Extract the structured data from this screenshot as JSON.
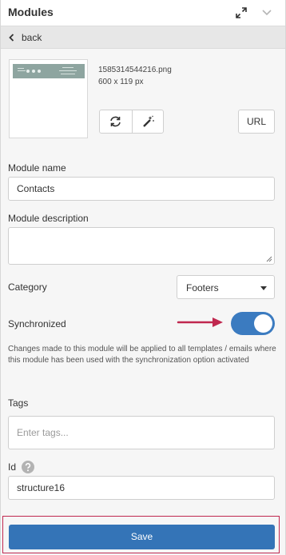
{
  "header": {
    "title": "Modules"
  },
  "back": {
    "label": "back"
  },
  "image": {
    "file_name": "1585314544216.png",
    "dimensions": "600 x 119 px"
  },
  "image_actions": {
    "url_label": "URL"
  },
  "module_name": {
    "label": "Module name",
    "value": "Contacts"
  },
  "module_description": {
    "label": "Module description",
    "value": ""
  },
  "category": {
    "label": "Category",
    "selected": "Footers"
  },
  "synchronized": {
    "label": "Synchronized",
    "enabled": true,
    "note": "Changes made to this module will be applied to all templates / emails where this module has been used with the synchronization option activated"
  },
  "tags": {
    "label": "Tags",
    "placeholder": "Enter tags..."
  },
  "id_field": {
    "label": "Id",
    "value": "structure16"
  },
  "save": {
    "label": "Save"
  },
  "colors": {
    "accent": "#3b7bc0",
    "save_button": "#3474b7",
    "arrow": "#c0284f"
  },
  "icons": [
    "expand-icon",
    "chevron-down-icon",
    "chevron-left-icon",
    "refresh-icon",
    "magic-wand-icon",
    "question-icon",
    "caret-down-icon"
  ]
}
